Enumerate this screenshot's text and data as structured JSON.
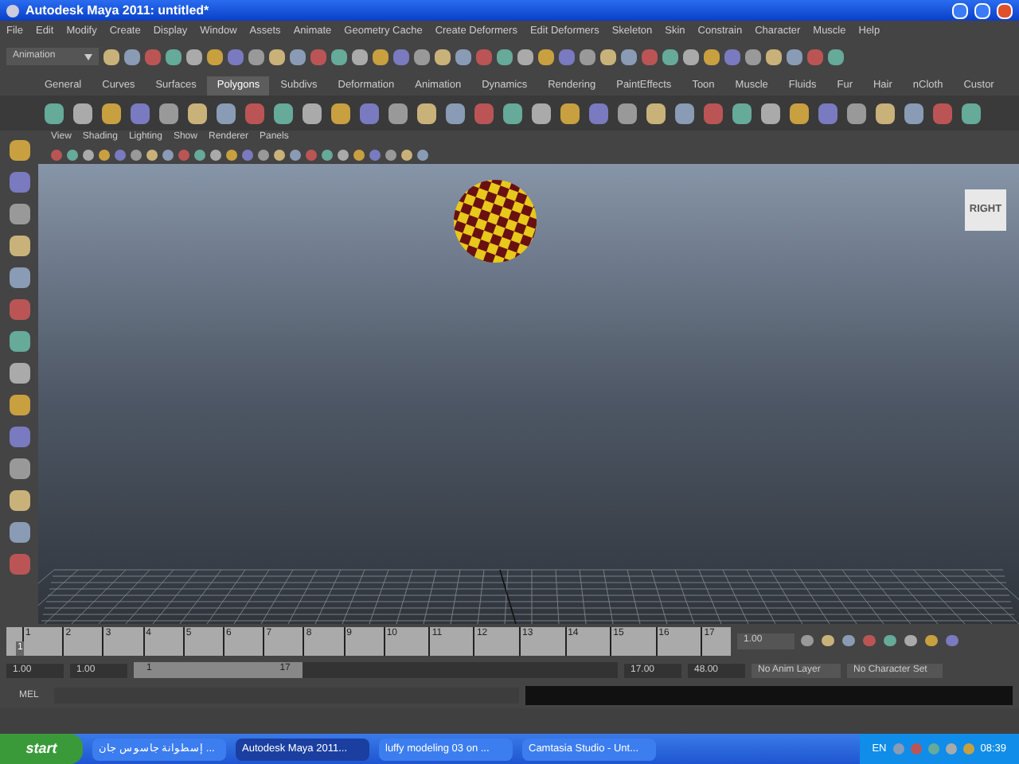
{
  "window": {
    "title": "Autodesk Maya 2011: untitled*"
  },
  "menu": [
    "File",
    "Edit",
    "Modify",
    "Create",
    "Display",
    "Window",
    "Assets",
    "Animate",
    "Geometry Cache",
    "Create Deformers",
    "Edit Deformers",
    "Skeleton",
    "Skin",
    "Constrain",
    "Character",
    "Muscle",
    "Help"
  ],
  "status_line": {
    "menu_set": "Animation"
  },
  "shelf_tabs": [
    {
      "label": "General",
      "selected": false
    },
    {
      "label": "Curves",
      "selected": false
    },
    {
      "label": "Surfaces",
      "selected": false
    },
    {
      "label": "Polygons",
      "selected": true
    },
    {
      "label": "Subdivs",
      "selected": false
    },
    {
      "label": "Deformation",
      "selected": false
    },
    {
      "label": "Animation",
      "selected": false
    },
    {
      "label": "Dynamics",
      "selected": false
    },
    {
      "label": "Rendering",
      "selected": false
    },
    {
      "label": "PaintEffects",
      "selected": false
    },
    {
      "label": "Toon",
      "selected": false
    },
    {
      "label": "Muscle",
      "selected": false
    },
    {
      "label": "Fluids",
      "selected": false
    },
    {
      "label": "Fur",
      "selected": false
    },
    {
      "label": "Hair",
      "selected": false
    },
    {
      "label": "nCloth",
      "selected": false
    },
    {
      "label": "Custor",
      "selected": false
    }
  ],
  "panel_menu": [
    "View",
    "Shading",
    "Lighting",
    "Show",
    "Renderer",
    "Panels"
  ],
  "viewport": {
    "view_cube": "RIGHT"
  },
  "time_slider": {
    "ticks": [
      "1",
      "2",
      "3",
      "4",
      "5",
      "6",
      "7",
      "8",
      "9",
      "10",
      "11",
      "12",
      "13",
      "14",
      "15",
      "16",
      "17"
    ],
    "current": "1",
    "level": 0,
    "current_time": "1.00"
  },
  "range_slider": {
    "start_time": "1.00",
    "playback_start": "1.00",
    "range_start": "1",
    "range_end": "17",
    "level": 0.35,
    "playback_end": "17.00",
    "end_time": "48.00",
    "anim_layer": "No Anim Layer",
    "character_set": "No Character Set"
  },
  "command_line": {
    "label": "MEL"
  },
  "taskbar": {
    "start": "start",
    "items": [
      {
        "label": "إسطوانة جاسوس جان ...",
        "selected": false
      },
      {
        "label": "Autodesk Maya 2011...",
        "selected": true
      },
      {
        "label": "luffy modeling 03 on ...",
        "selected": false
      },
      {
        "label": "Camtasia Studio - Unt...",
        "selected": false
      }
    ],
    "language": "EN",
    "clock": "08:39"
  }
}
